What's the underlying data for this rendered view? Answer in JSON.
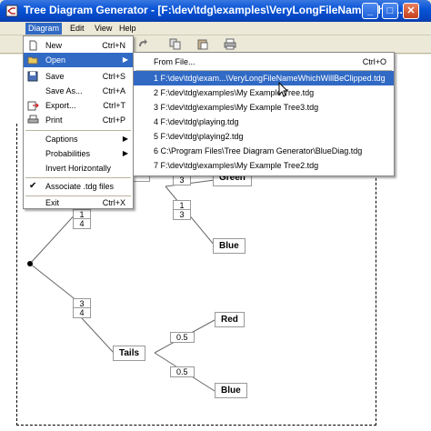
{
  "window": {
    "title": "Tree Diagram Generator - [F:\\dev\\tdg\\examples\\VeryLongFileNameWhic..."
  },
  "menubar": {
    "items": [
      "Diagram",
      "Edit",
      "View",
      "Help"
    ]
  },
  "diagram_menu": {
    "items": [
      {
        "label": "New",
        "shortcut": "Ctrl+N",
        "icon": "new-file-icon"
      },
      {
        "label": "Open",
        "shortcut": "",
        "icon": "open-folder-icon",
        "submenu": true
      },
      {
        "label": "Save",
        "shortcut": "Ctrl+S",
        "icon": "save-icon"
      },
      {
        "label": "Save As...",
        "shortcut": "Ctrl+A",
        "icon": ""
      },
      {
        "label": "Export...",
        "shortcut": "Ctrl+T",
        "icon": "export-icon"
      },
      {
        "label": "Print",
        "shortcut": "Ctrl+P",
        "icon": "print-icon"
      },
      {
        "label": "Captions",
        "shortcut": "",
        "submenu": true
      },
      {
        "label": "Probabilities",
        "shortcut": "",
        "submenu": true
      },
      {
        "label": "Invert Horizontally",
        "shortcut": ""
      },
      {
        "label": "Associate .tdg files",
        "shortcut": "",
        "checked": true
      },
      {
        "label": "Exit",
        "shortcut": "Ctrl+X"
      }
    ]
  },
  "open_submenu": {
    "from_file": {
      "label": "From File...",
      "shortcut": "Ctrl+O"
    },
    "recent": [
      "1 F:\\dev\\tdg\\exam...\\VeryLongFileNameWhichWillBeClipped.tdg",
      "2 F:\\dev\\tdg\\examples\\My Example Tree.tdg",
      "3 F:\\dev\\tdg\\examples\\My Example Tree3.tdg",
      "4 F:\\dev\\tdg\\playing.tdg",
      "5 F:\\dev\\tdg\\playing2.tdg",
      "6 C:\\Program Files\\Tree Diagram Generator\\BlueDiag.tdg",
      "7 F:\\dev\\tdg\\examples\\My Example Tree2.tdg"
    ]
  },
  "tree": {
    "upper_branch_prob": {
      "num": "1",
      "den": "4"
    },
    "lower_branch_prob": {
      "num": "3",
      "den": "4"
    },
    "heads_partial": "ds",
    "green_partial": "Green",
    "upper_prob_top": {
      "num": "",
      "den": "3"
    },
    "upper_prob_blue": {
      "num": "1",
      "den": "3"
    },
    "blue_label_upper": "Blue",
    "tails_label": "Tails",
    "red_label": "Red",
    "blue_label_lower": "Blue",
    "prob_red": "0.5",
    "prob_blue": "0.5"
  }
}
